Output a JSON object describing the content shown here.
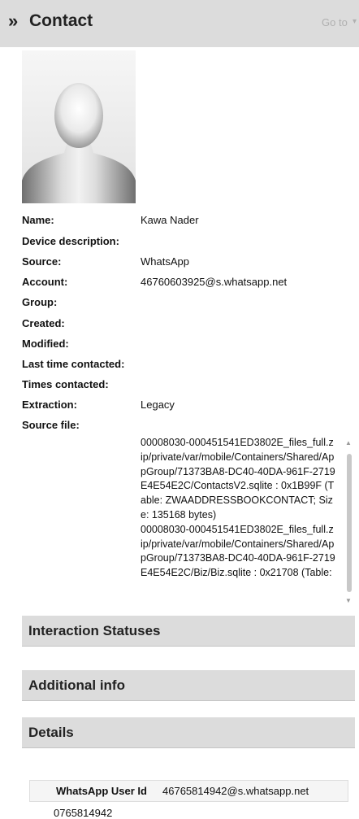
{
  "header": {
    "title": "Contact",
    "goto_label": "Go to",
    "chevron": "»"
  },
  "avatar": {
    "icon": "contact-placeholder-silhouette"
  },
  "fields": [
    {
      "label": "Name:",
      "value": "Kawa Nader"
    },
    {
      "label": "Device description:",
      "value": ""
    },
    {
      "label": "Source:",
      "value": "WhatsApp"
    },
    {
      "label": "Account:",
      "value": "46760603925@s.whatsapp.net"
    },
    {
      "label": "Group:",
      "value": ""
    },
    {
      "label": "Created:",
      "value": ""
    },
    {
      "label": "Modified:",
      "value": ""
    },
    {
      "label": "Last time contacted:",
      "value": ""
    },
    {
      "label": "Times contacted:",
      "value": ""
    },
    {
      "label": "Extraction:",
      "value": "Legacy"
    }
  ],
  "source_file": {
    "label": "Source file:",
    "value": "00008030-000451541ED3802E_files_full.zip/private/var/mobile/Containers/Shared/AppGroup/71373BA8-DC40-40DA-961F-2719E4E54E2C/ContactsV2.sqlite : 0x1B99F (Table: ZWAADDRESSBOOKCONTACT; Size: 135168 bytes)\n00008030-000451541ED3802E_files_full.zip/private/var/mobile/Containers/Shared/AppGroup/71373BA8-DC40-40DA-961F-2719E4E54E2C/Biz/Biz.sqlite : 0x21708 (Table:"
  },
  "sections": {
    "interaction": "Interaction Statuses",
    "additional": "Additional info",
    "details": "Details"
  },
  "details": {
    "key": "WhatsApp User Id",
    "value": "46765814942@s.whatsapp.net",
    "extra": "0765814942"
  }
}
